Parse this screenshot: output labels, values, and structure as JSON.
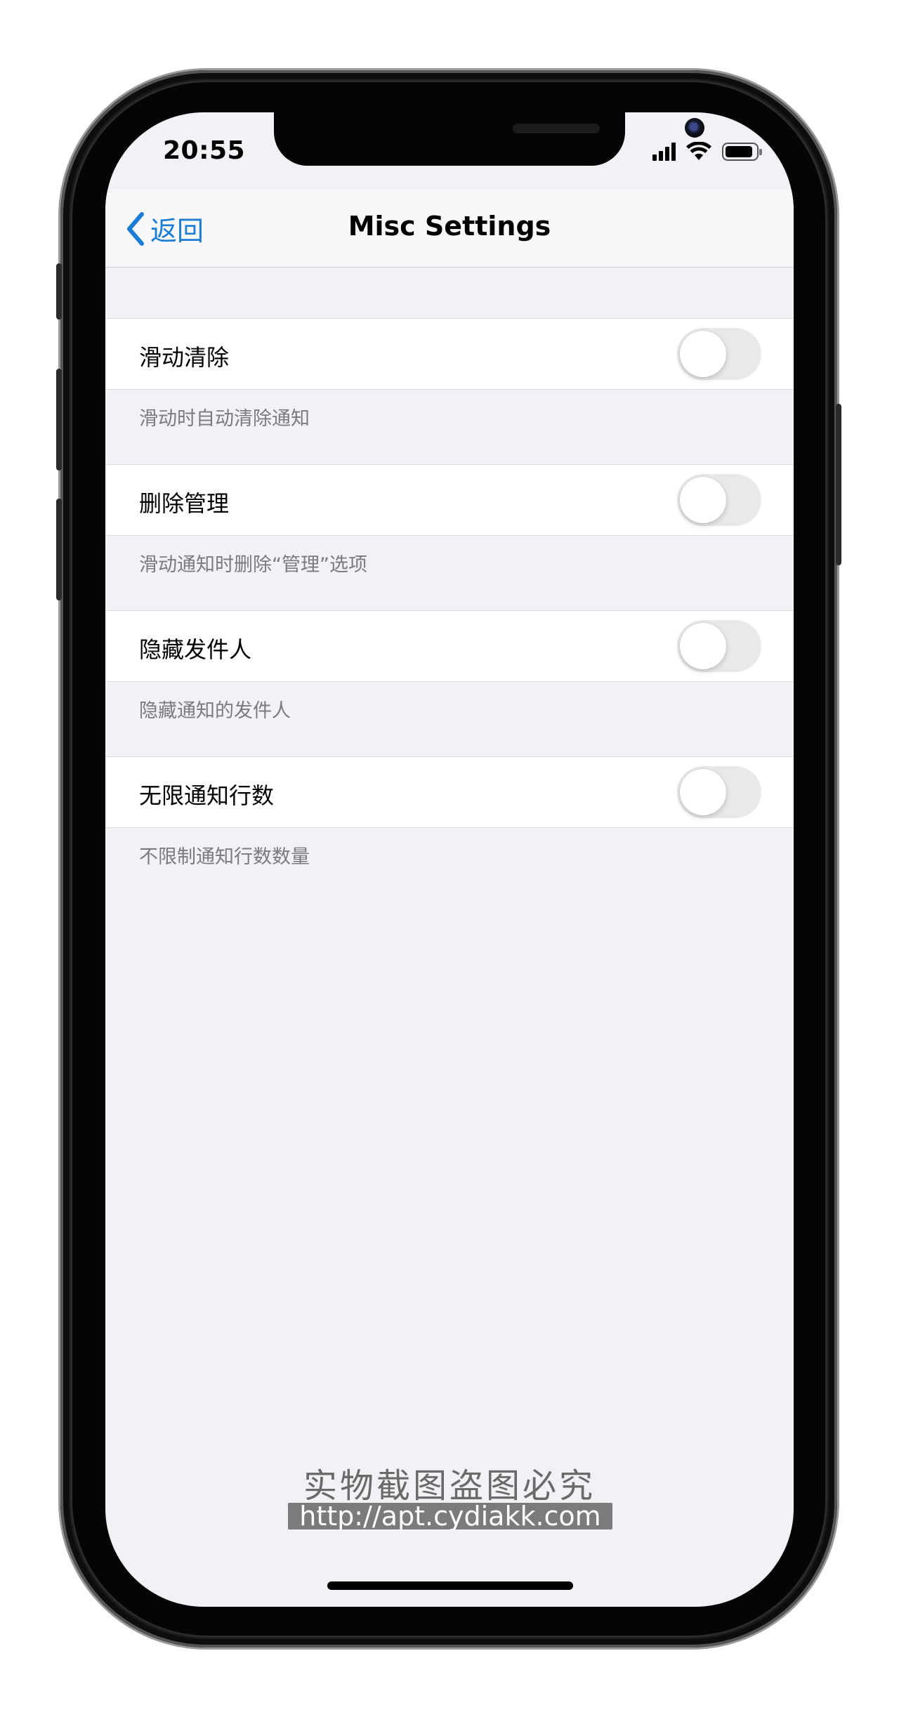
{
  "status_bar": {
    "time": "20:55",
    "signal_icon": "cellular-signal-icon",
    "wifi_icon": "wifi-icon",
    "battery_icon": "battery-icon"
  },
  "navbar": {
    "back_label": "返回",
    "back_icon": "chevron-left-icon",
    "title": "Misc Settings",
    "accent_color": "#1b7dd6"
  },
  "settings": [
    {
      "label": "滑动清除",
      "footer": "滑动时自动清除通知",
      "enabled": false
    },
    {
      "label": "删除管理",
      "footer": "滑动通知时删除“管理”选项",
      "enabled": false
    },
    {
      "label": "隐藏发件人",
      "footer": "隐藏通知的发件人",
      "enabled": false
    },
    {
      "label": "无限通知行数",
      "footer": "不限制通知行数数量",
      "enabled": false
    }
  ],
  "watermark": {
    "title": "实物截图盗图必究",
    "url": "http://apt.cydiakk.com"
  }
}
